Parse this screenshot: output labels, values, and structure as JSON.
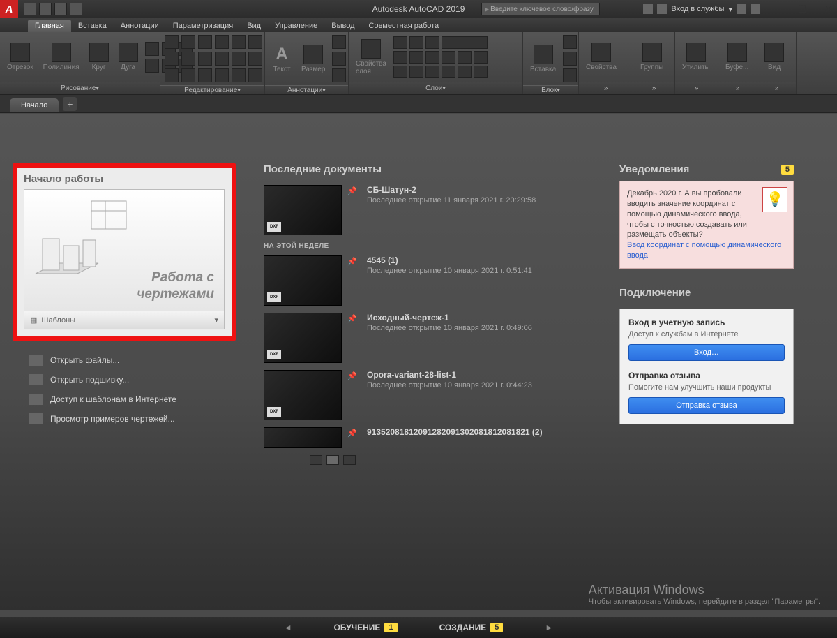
{
  "title": "Autodesk AutoCAD 2019",
  "search_placeholder": "Введите ключевое слово/фразу",
  "signin": "Вход в службы",
  "menu": {
    "tabs": [
      "Главная",
      "Вставка",
      "Аннотации",
      "Параметризация",
      "Вид",
      "Управление",
      "Вывод",
      "Совместная работа"
    ],
    "active": 0
  },
  "ribbon": {
    "draw": {
      "title": "Рисование",
      "items": [
        "Отрезок",
        "Полилиния",
        "Круг",
        "Дуга"
      ]
    },
    "edit": {
      "title": "Редактирование"
    },
    "anno": {
      "title": "Аннотации",
      "text": "Текст",
      "dim": "Размер"
    },
    "layers": {
      "title": "Слои",
      "props": "Свойства\nслоя"
    },
    "block": {
      "title": "Блок",
      "insert": "Вставка"
    },
    "props": {
      "label": "Свойства"
    },
    "groups": {
      "label": "Группы"
    },
    "utils": {
      "label": "Утилиты"
    },
    "buffer": {
      "label": "Буфе..."
    },
    "view": {
      "label": "Вид"
    }
  },
  "doctab": "Начало",
  "left": {
    "heading": "Начало работы",
    "card_l1": "Работа с",
    "card_l2": "чертежами",
    "templates": "Шаблоны",
    "links": [
      "Открыть файлы...",
      "Открыть подшивку...",
      "Доступ к шаблонам в Интернете",
      "Просмотр примеров чертежей..."
    ]
  },
  "mid": {
    "heading": "Последние документы",
    "week_label": "НА ЭТОЙ НЕДЕЛЕ",
    "thumb_tag": "DXF",
    "docs": [
      {
        "name": "СБ-Шатун-2",
        "meta": "Последнее открытие 11 января 2021 г. 20:29:58"
      },
      {
        "name": "4545 (1)",
        "meta": "Последнее открытие 10 января 2021 г. 0:51:41"
      },
      {
        "name": "Исходный-чертеж-1",
        "meta": "Последнее открытие 10 января 2021 г. 0:49:06"
      },
      {
        "name": "Opora-variant-28-list-1",
        "meta": "Последнее открытие 10 января 2021 г. 0:44:23"
      },
      {
        "name": "91352081812091282091302081812081821 (2)",
        "meta": ""
      }
    ]
  },
  "right": {
    "notif_heading": "Уведомления",
    "notif_count": "5",
    "notif_text": "Декабрь 2020 г. А вы пробовали вводить значение координат с помощью динамического ввода, чтобы с точностью создавать или размещать объекты?",
    "notif_link": "Ввод координат с помощью динамического ввода",
    "conn_heading": "Подключение",
    "signin_title": "Вход в учетную запись",
    "signin_desc": "Доступ к службам в Интернете",
    "signin_btn": "Вход…",
    "feedback_title": "Отправка отзыва",
    "feedback_desc": "Помогите нам улучшить наши продукты",
    "feedback_btn": "Отправка отзыва"
  },
  "watermark": {
    "title": "Активация Windows",
    "sub": "Чтобы активировать Windows, перейдите в раздел \"Параметры\"."
  },
  "bottom": {
    "learn": "ОБУЧЕНИЕ",
    "learn_n": "1",
    "create": "СОЗДАНИЕ",
    "create_n": "5"
  }
}
